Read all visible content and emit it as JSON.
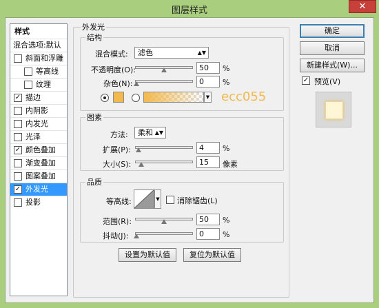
{
  "window": {
    "title": "图层样式",
    "close_label": "✕"
  },
  "sidebar": {
    "header": "样式",
    "items": [
      {
        "label": "混合选项:默认",
        "checkbox": false,
        "checked": false,
        "indent": false,
        "selected": false
      },
      {
        "label": "斜面和浮雕",
        "checkbox": true,
        "checked": false,
        "indent": false,
        "selected": false
      },
      {
        "label": "等高线",
        "checkbox": true,
        "checked": false,
        "indent": true,
        "selected": false
      },
      {
        "label": "纹理",
        "checkbox": true,
        "checked": false,
        "indent": true,
        "selected": false
      },
      {
        "label": "描边",
        "checkbox": true,
        "checked": true,
        "indent": false,
        "selected": false
      },
      {
        "label": "内阴影",
        "checkbox": true,
        "checked": false,
        "indent": false,
        "selected": false
      },
      {
        "label": "内发光",
        "checkbox": true,
        "checked": false,
        "indent": false,
        "selected": false
      },
      {
        "label": "光泽",
        "checkbox": true,
        "checked": false,
        "indent": false,
        "selected": false
      },
      {
        "label": "颜色叠加",
        "checkbox": true,
        "checked": true,
        "indent": false,
        "selected": false
      },
      {
        "label": "渐变叠加",
        "checkbox": true,
        "checked": false,
        "indent": false,
        "selected": false
      },
      {
        "label": "图案叠加",
        "checkbox": true,
        "checked": false,
        "indent": false,
        "selected": false
      },
      {
        "label": "外发光",
        "checkbox": true,
        "checked": true,
        "indent": false,
        "selected": true
      },
      {
        "label": "投影",
        "checkbox": true,
        "checked": false,
        "indent": false,
        "selected": false
      }
    ]
  },
  "panel": {
    "title": "外发光",
    "structure": {
      "label": "结构",
      "blend_mode_label": "混合模式:",
      "blend_mode_value": "滤色",
      "opacity_label": "不透明度(O):",
      "opacity_value": "50",
      "opacity_unit": "%",
      "noise_label": "杂色(N):",
      "noise_value": "0",
      "noise_unit": "%",
      "color_swatch": "#f2b94e",
      "watermark": "ecc055"
    },
    "elements": {
      "label": "图素",
      "technique_label": "方法:",
      "technique_value": "柔和",
      "spread_label": "扩展(P):",
      "spread_value": "4",
      "spread_unit": "%",
      "size_label": "大小(S):",
      "size_value": "15",
      "size_unit": "像素"
    },
    "quality": {
      "label": "品质",
      "contour_label": "等高线:",
      "antialias_label": "消除锯齿(L)",
      "range_label": "范围(R):",
      "range_value": "50",
      "range_unit": "%",
      "jitter_label": "抖动(J):",
      "jitter_value": "0",
      "jitter_unit": "%"
    },
    "make_default": "设置为默认值",
    "reset_default": "复位为默认值"
  },
  "buttons": {
    "ok": "确定",
    "cancel": "取消",
    "new_style": "新建样式(W)...",
    "preview": "预览(V)"
  },
  "colors": {
    "accent": "#3399ff",
    "glow": "#f2b94e",
    "preview_fill": "#fff6d6"
  }
}
